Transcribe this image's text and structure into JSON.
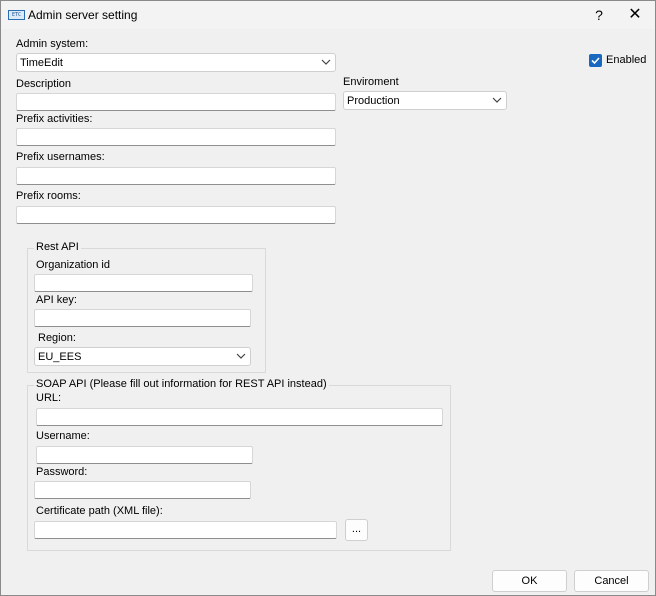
{
  "window": {
    "title": "Admin server setting",
    "help_label": "?",
    "close_label": "✕",
    "app_icon_text": "ETC"
  },
  "form": {
    "admin_system_label": "Admin system:",
    "admin_system_value": "TimeEdit",
    "enabled_label": "Enabled",
    "enabled_checked": true,
    "description_label": "Description",
    "environment_label": "Enviroment",
    "environment_value": "Production",
    "prefix_activities_label": "Prefix activities:",
    "prefix_usernames_label": "Prefix usernames:",
    "prefix_rooms_label": "Prefix rooms:"
  },
  "rest_api": {
    "title": "Rest API",
    "organization_id_label": "Organization id",
    "api_key_label": "API key:",
    "region_label": "Region:",
    "region_value": "EU_EES"
  },
  "soap_api": {
    "title": "SOAP API (Please fill out information for REST API instead)",
    "url_label": "URL:",
    "username_label": "Username:",
    "password_label": "Password:",
    "certificate_label": "Certificate path (XML file):",
    "browse_label": "..."
  },
  "footer": {
    "ok_label": "OK",
    "cancel_label": "Cancel"
  },
  "colors": {
    "accent": "#1868c0",
    "background": "#f0f0f0"
  }
}
